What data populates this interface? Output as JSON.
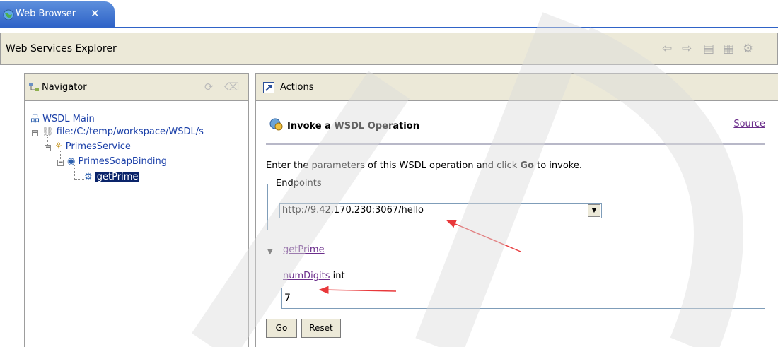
{
  "tab": {
    "title": "Web Browser",
    "close": "✕"
  },
  "explorer": {
    "title": "Web Services Explorer"
  },
  "toolbar_icons": [
    "back-arrow-icon",
    "forward-arrow-icon",
    "history-icon",
    "favorites-icon",
    "wsdl-icon"
  ],
  "navigator": {
    "title": "Navigator",
    "tree": {
      "root": "WSDL Main",
      "file": "file:/C:/temp/workspace/WSDL/s",
      "service": "PrimesService",
      "binding": "PrimesSoapBinding",
      "operation": "getPrime"
    }
  },
  "actions": {
    "title": "Actions",
    "operation_title": "Invoke a WSDL Operation",
    "source_link": "Source",
    "instructions_before": "Enter the parameters of this WSDL operation and click ",
    "instructions_bold": "Go",
    "instructions_after": " to invoke.",
    "endpoints_legend": "Endpoints",
    "endpoint_value": "http://9.42.170.230:3067/hello",
    "operation_link": "getPrime",
    "param_name": "numDigits",
    "param_type": "int",
    "param_value": "7",
    "go_label": "Go",
    "reset_label": "Reset"
  },
  "colors": {
    "tab": "#2f63c7",
    "link": "#6b2e8b",
    "selection": "#0a246a",
    "arrow": "#e8383a",
    "chrome": "#ece9d8"
  }
}
